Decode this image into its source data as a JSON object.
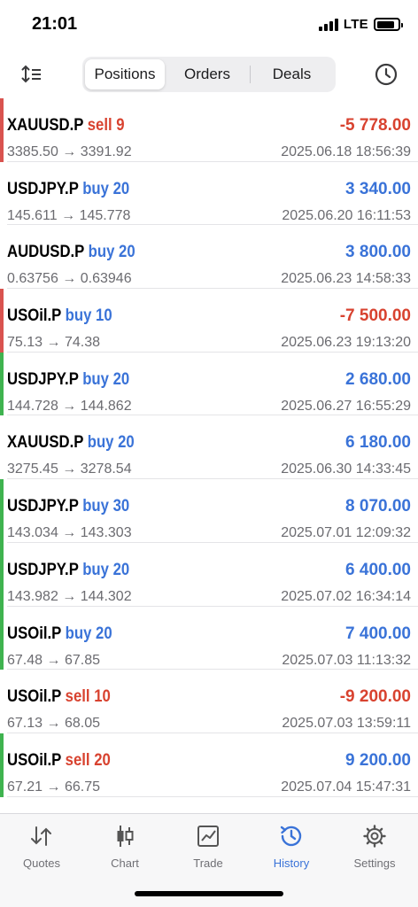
{
  "status": {
    "time": "21:01",
    "network": "LTE",
    "battery_level": 0.85
  },
  "toolbar": {
    "sort_icon": "sort-arrows-icon",
    "segments": [
      "Positions",
      "Orders",
      "Deals"
    ],
    "active_segment": "Positions",
    "history_icon": "clock-icon"
  },
  "colors": {
    "profit": "#3a73d8",
    "loss": "#d8422f",
    "marker_loss": "#d9534f",
    "marker_profit": "#3fb34f",
    "accent": "#3a73d8"
  },
  "trades": [
    {
      "symbol": "XAUUSD.P",
      "side": "sell 9",
      "side_type": "sell",
      "open": "3385.50",
      "close": "3391.92",
      "profit": "-5 778.00",
      "datetime": "2025.06.18 18:56:39",
      "marker": "loss"
    },
    {
      "symbol": "USDJPY.P",
      "side": "buy 20",
      "side_type": "buy",
      "open": "145.611",
      "close": "145.778",
      "profit": "3 340.00",
      "datetime": "2025.06.20 16:11:53",
      "marker": "none"
    },
    {
      "symbol": "AUDUSD.P",
      "side": "buy 20",
      "side_type": "buy",
      "open": "0.63756",
      "close": "0.63946",
      "profit": "3 800.00",
      "datetime": "2025.06.23 14:58:33",
      "marker": "none"
    },
    {
      "symbol": "USOil.P",
      "side": "buy 10",
      "side_type": "buy",
      "open": "75.13",
      "close": "74.38",
      "profit": "-7 500.00",
      "datetime": "2025.06.23 19:13:20",
      "marker": "loss"
    },
    {
      "symbol": "USDJPY.P",
      "side": "buy 20",
      "side_type": "buy",
      "open": "144.728",
      "close": "144.862",
      "profit": "2 680.00",
      "datetime": "2025.06.27 16:55:29",
      "marker": "profit"
    },
    {
      "symbol": "XAUUSD.P",
      "side": "buy 20",
      "side_type": "buy",
      "open": "3275.45",
      "close": "3278.54",
      "profit": "6 180.00",
      "datetime": "2025.06.30 14:33:45",
      "marker": "none"
    },
    {
      "symbol": "USDJPY.P",
      "side": "buy 30",
      "side_type": "buy",
      "open": "143.034",
      "close": "143.303",
      "profit": "8 070.00",
      "datetime": "2025.07.01 12:09:32",
      "marker": "profit"
    },
    {
      "symbol": "USDJPY.P",
      "side": "buy 20",
      "side_type": "buy",
      "open": "143.982",
      "close": "144.302",
      "profit": "6 400.00",
      "datetime": "2025.07.02 16:34:14",
      "marker": "profit"
    },
    {
      "symbol": "USOil.P",
      "side": "buy 20",
      "side_type": "buy",
      "open": "67.48",
      "close": "67.85",
      "profit": "7 400.00",
      "datetime": "2025.07.03 11:13:32",
      "marker": "profit"
    },
    {
      "symbol": "USOil.P",
      "side": "sell 10",
      "side_type": "sell",
      "open": "67.13",
      "close": "68.05",
      "profit": "-9 200.00",
      "datetime": "2025.07.03 13:59:11",
      "marker": "none"
    },
    {
      "symbol": "USOil.P",
      "side": "sell 20",
      "side_type": "sell",
      "open": "67.21",
      "close": "66.75",
      "profit": "9 200.00",
      "datetime": "2025.07.04 15:47:31",
      "marker": "profit"
    }
  ],
  "arrow": "→",
  "tabs": [
    {
      "label": "Quotes",
      "icon": "quotes-arrows-icon"
    },
    {
      "label": "Chart",
      "icon": "candlestick-icon"
    },
    {
      "label": "Trade",
      "icon": "trade-chart-icon"
    },
    {
      "label": "History",
      "icon": "history-clock-icon"
    },
    {
      "label": "Settings",
      "icon": "gear-icon"
    }
  ],
  "active_tab": "History"
}
